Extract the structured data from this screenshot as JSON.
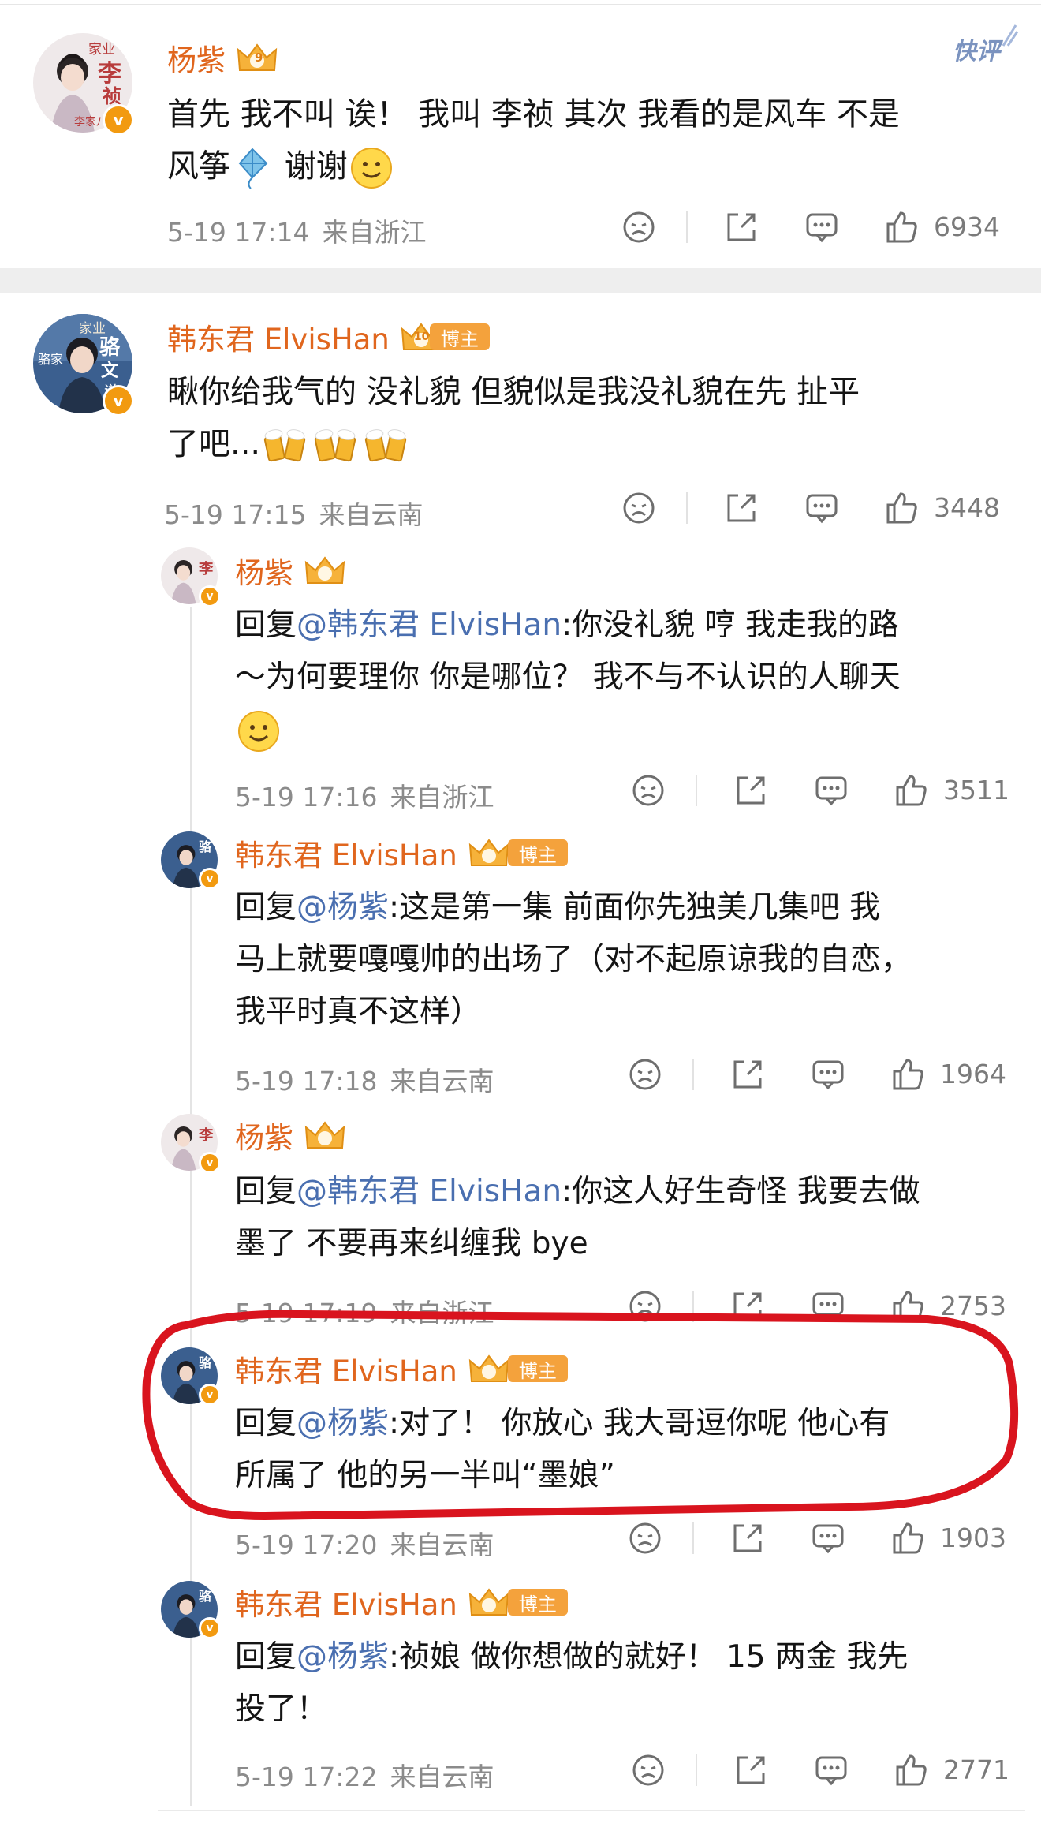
{
  "colors": {
    "username": "#e0661e",
    "mention": "#4a6fb0",
    "meta": "#8b8b8b",
    "annotation": "#d9141e",
    "badge": "#f29a10"
  },
  "quick_reply_label": "快评",
  "badges": {
    "vip_level": "9",
    "vip_level2": "10",
    "blogger": "博主",
    "verified": "v"
  },
  "posts": [
    {
      "user": "杨紫",
      "avatar_text": [
        "家业",
        "李",
        "祯",
        "李家八房"
      ],
      "line1": "首先 我不叫 诶！  我叫 李祯 其次 我看的是风车 不是",
      "line2a": "风筝",
      "line2b": " 谢谢",
      "time": "5-19 17:14",
      "source": "来自浙江",
      "likes": "6934"
    },
    {
      "user": "韩东君 ElvisHan",
      "avatar_text": [
        "家业",
        "骆",
        "文",
        "谦",
        "骆家"
      ],
      "line1": "瞅你给我气的  没礼貌   但貌似是我没礼貌在先   扯平",
      "line2": "了吧...",
      "time": "5-19 17:15",
      "source": "来自云南",
      "likes": "3448"
    }
  ],
  "replies": [
    {
      "user": "杨紫",
      "prefix": "回复",
      "mention": "@韩东君 ElvisHan",
      "line1": ":你没礼貌 哼 我走我的路",
      "line2": "～为何要理你 你是哪位？ 我不与不认识的人聊天",
      "time": "5-19 17:16",
      "source": "来自浙江",
      "likes": "3511"
    },
    {
      "user": "韩东君 ElvisHan",
      "prefix": "回复",
      "mention": "@杨紫",
      "line1": ":这是第一集  前面你先独美几集吧   我",
      "line2": "马上就要嘎嘎帅的出场了（对不起原谅我的自恋，",
      "line3": "我平时真不这样）",
      "time": "5-19 17:18",
      "source": "来自云南",
      "likes": "1964"
    },
    {
      "user": "杨紫",
      "prefix": "回复",
      "mention": "@韩东君 ElvisHan",
      "line1": ":你这人好生奇怪 我要去做",
      "line2": "墨了 不要再来纠缠我 bye",
      "time": "5-19 17:19",
      "source": "来自浙江",
      "likes": "2753"
    },
    {
      "user": "韩东君 ElvisHan",
      "prefix": "回复",
      "mention": "@杨紫",
      "line1": ":对了！ 你放心 我大哥逗你呢  他心有",
      "line2": "所属了  他的另一半叫“墨娘”",
      "time": "5-19 17:20",
      "source": "来自云南",
      "likes": "1903"
    },
    {
      "user": "韩东君 ElvisHan",
      "prefix": "回复",
      "mention": "@杨紫",
      "line1": ":祯娘  做你想做的就好！ 15 两金  我先",
      "line2": "投了！",
      "time": "5-19 17:22",
      "source": "来自云南",
      "likes": "2771"
    }
  ]
}
